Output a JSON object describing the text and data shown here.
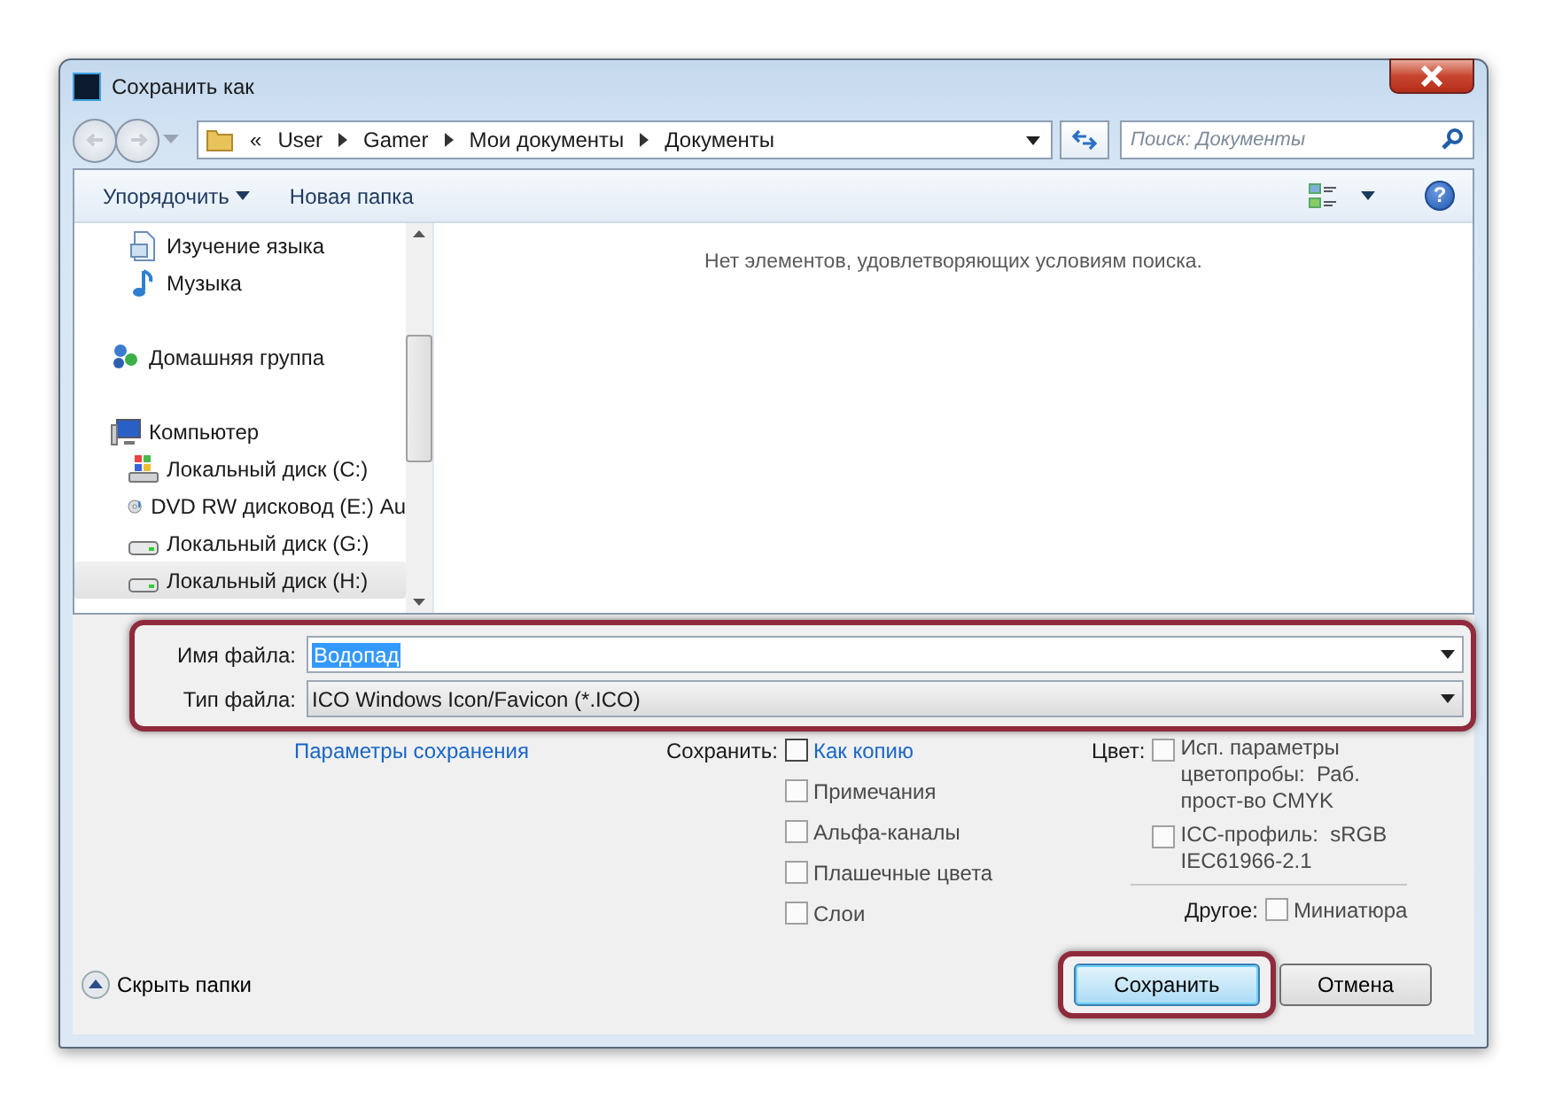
{
  "window": {
    "title": "Сохранить как"
  },
  "address_bar": {
    "breadcrumb": [
      "«",
      "User",
      "Gamer",
      "Мои документы",
      "Документы"
    ]
  },
  "search": {
    "placeholder": "Поиск: Документы"
  },
  "toolbar": {
    "organize": "Упорядочить",
    "new_folder": "Новая папка",
    "help": "?"
  },
  "sidebar": {
    "items": [
      {
        "label": "Изучение языка",
        "kind": "library",
        "selected": false
      },
      {
        "label": "Музыка",
        "kind": "music",
        "selected": false
      },
      {
        "label": "Домашняя группа",
        "kind": "homegroup",
        "selected": false
      },
      {
        "label": "Компьютер",
        "kind": "computer",
        "selected": false,
        "children": [
          {
            "label": "Локальный диск (C:)",
            "kind": "system-drive",
            "selected": false
          },
          {
            "label": "DVD RW дисковод (E:) Au",
            "kind": "dvd",
            "selected": false
          },
          {
            "label": "Локальный диск (G:)",
            "kind": "drive",
            "selected": false
          },
          {
            "label": "Локальный диск (H:)",
            "kind": "drive",
            "selected": true
          }
        ]
      }
    ]
  },
  "content": {
    "empty_message": "Нет элементов, удовлетворяющих условиям поиска."
  },
  "file_name": {
    "label": "Имя файла:",
    "value": "Водопад"
  },
  "file_type": {
    "label": "Тип файла:",
    "value": "ICO Windows Icon/Favicon (*.ICO)"
  },
  "save_options_link": "Параметры сохранения",
  "save_group": {
    "label": "Сохранить:",
    "options": [
      {
        "label": "Как копию",
        "checked": false,
        "focused": true
      },
      {
        "label": "Примечания",
        "checked": false,
        "focused": false
      },
      {
        "label": "Альфа-каналы",
        "checked": false,
        "focused": false
      },
      {
        "label": "Плашечные цвета",
        "checked": false,
        "focused": false
      },
      {
        "label": "Слои",
        "checked": false,
        "focused": false
      }
    ]
  },
  "color_group": {
    "label": "Цвет:",
    "options": [
      {
        "label": "Исп. параметры цветопробы:  Раб. прост-во CMYK",
        "checked": false
      },
      {
        "label": "ICC-профиль:  sRGB IEC61966-2.1",
        "checked": false
      }
    ]
  },
  "other_group": {
    "label": "Другое:",
    "options": [
      {
        "label": "Миниатюра",
        "checked": false
      }
    ]
  },
  "hide_folders": "Скрыть папки",
  "buttons": [
    {
      "label": "Сохранить",
      "kind": "primary"
    },
    {
      "label": "Отмена",
      "kind": "secondary"
    }
  ]
}
